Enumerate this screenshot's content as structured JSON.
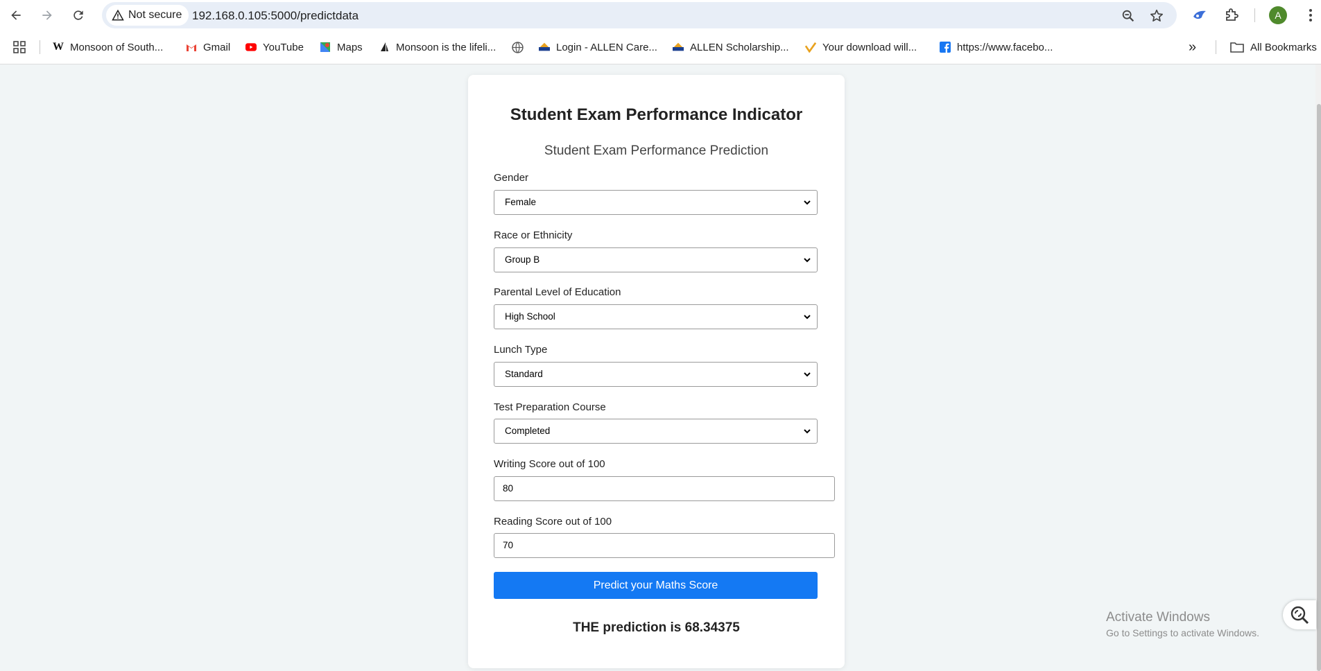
{
  "browser": {
    "security_label": "Not secure",
    "url": "192.168.0.105:5000/predictdata",
    "avatar_letter": "A",
    "bookmarks": [
      {
        "label": "Monsoon of South..."
      },
      {
        "label": "Gmail"
      },
      {
        "label": "YouTube"
      },
      {
        "label": "Maps"
      },
      {
        "label": "Monsoon is the lifeli..."
      },
      {
        "label": "Login - ALLEN Care..."
      },
      {
        "label": "ALLEN Scholarship..."
      },
      {
        "label": "Your download will..."
      },
      {
        "label": "https://www.facebo..."
      }
    ],
    "all_bookmarks": "All Bookmarks",
    "overflow": "»"
  },
  "page": {
    "title": "Student Exam Performance Indicator",
    "subtitle": "Student Exam Performance Prediction",
    "fields": {
      "gender": {
        "label": "Gender",
        "value": "Female"
      },
      "ethnicity": {
        "label": "Race or Ethnicity",
        "value": "Group B"
      },
      "parental_education": {
        "label": "Parental Level of Education",
        "value": "High School"
      },
      "lunch": {
        "label": "Lunch Type",
        "value": "Standard"
      },
      "test_prep": {
        "label": "Test Preparation Course",
        "value": "Completed"
      },
      "writing": {
        "label": "Writing Score out of 100",
        "value": "80"
      },
      "reading": {
        "label": "Reading Score out of 100",
        "value": "70"
      }
    },
    "submit_label": "Predict your Maths Score",
    "result_text": "THE prediction is 68.34375"
  },
  "watermark": {
    "line1": "Activate Windows",
    "line2": "Go to Settings to activate Windows."
  },
  "colors": {
    "accent": "#1479f3",
    "background": "#f1f5f6"
  }
}
